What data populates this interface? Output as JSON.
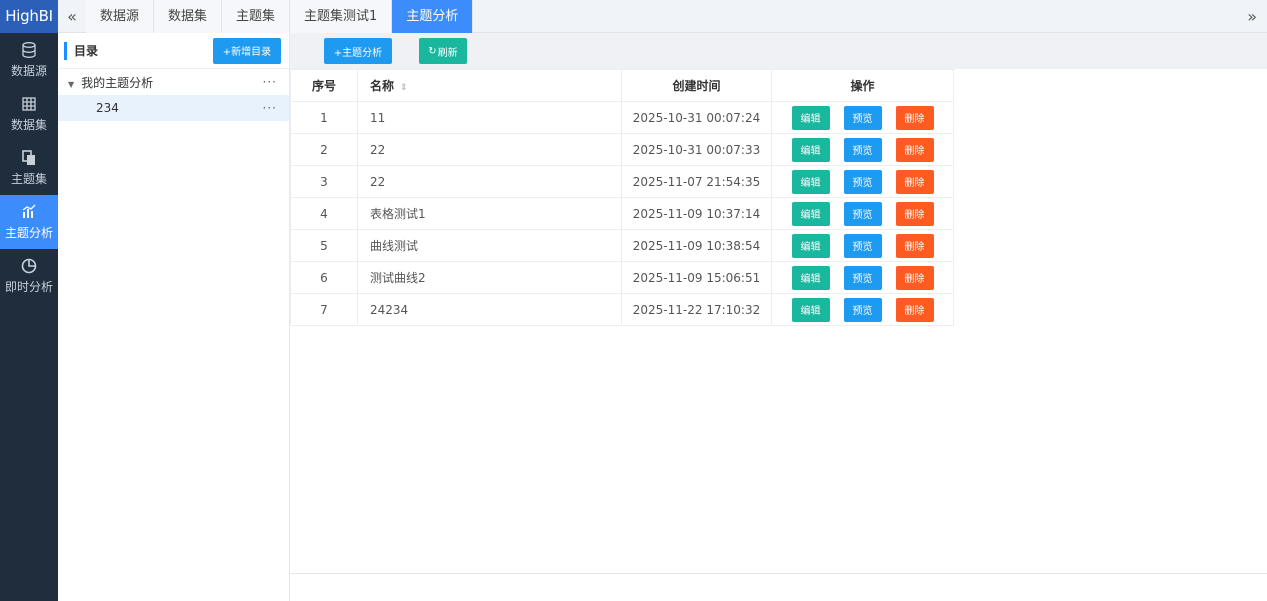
{
  "app": {
    "brand": "HighBI"
  },
  "nav": [
    {
      "label": "数据源",
      "icon": "database-icon",
      "active": false
    },
    {
      "label": "数据集",
      "icon": "table-grid-icon",
      "active": false
    },
    {
      "label": "主题集",
      "icon": "copy-layers-icon",
      "active": false
    },
    {
      "label": "主题分析",
      "icon": "bar-chart-icon",
      "active": true
    },
    {
      "label": "即时分析",
      "icon": "pie-chart-icon",
      "active": false
    }
  ],
  "tabs": [
    {
      "label": "数据源",
      "active": false
    },
    {
      "label": "数据集",
      "active": false
    },
    {
      "label": "主题集",
      "active": false
    },
    {
      "label": "主题集测试1",
      "active": false
    },
    {
      "label": "主题分析",
      "active": true
    }
  ],
  "directory": {
    "title": "目录",
    "add_button": "+新增目录",
    "tree": [
      {
        "label": "我的主题分析",
        "level": 0,
        "expanded": true
      },
      {
        "label": "234",
        "level": 1,
        "selected": true
      }
    ],
    "more": "···"
  },
  "toolbar": {
    "add_label": "+主题分析",
    "refresh_label": "刷新"
  },
  "table": {
    "headers": {
      "index": "序号",
      "name": "名称",
      "created": "创建时间",
      "ops": "操作"
    },
    "actions": {
      "edit": "编辑",
      "preview": "预览",
      "delete": "删除"
    },
    "rows": [
      {
        "index": "1",
        "name": "11",
        "created": "2025-10-31 00:07:24"
      },
      {
        "index": "2",
        "name": "22",
        "created": "2025-10-31 00:07:33"
      },
      {
        "index": "3",
        "name": "22",
        "created": "2025-11-07 21:54:35"
      },
      {
        "index": "4",
        "name": "表格测试1",
        "created": "2025-11-09 10:37:14"
      },
      {
        "index": "5",
        "name": "曲线测试",
        "created": "2025-11-09 10:38:54"
      },
      {
        "index": "6",
        "name": "测试曲线2",
        "created": "2025-11-09 15:06:51"
      },
      {
        "index": "7",
        "name": "24234",
        "created": "2025-11-22 17:10:32"
      }
    ]
  },
  "colors": {
    "nav_bg": "#1f2d3d",
    "accent": "#3c8dfb",
    "blue_btn": "#1e9bf0",
    "teal_btn": "#19b89e",
    "orange_btn": "#ff5a22"
  }
}
